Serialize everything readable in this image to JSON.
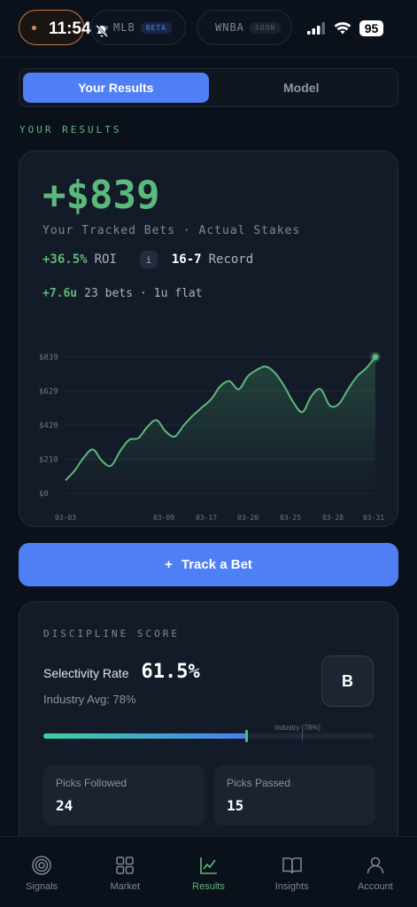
{
  "status": {
    "time": "11:54",
    "battery": "95"
  },
  "sports": [
    {
      "label": "MLB",
      "badge": "BETA"
    },
    {
      "label": "WNBA",
      "badge": "SOON"
    }
  ],
  "tabs": {
    "results": "Your Results",
    "model": "Model"
  },
  "section_label": "YOUR RESULTS",
  "results": {
    "amount": "+$839",
    "subtitle": "Your Tracked Bets · Actual Stakes",
    "roi": "+36.5%",
    "roi_label": "ROI",
    "info_icon": "i",
    "record": "16-7",
    "record_label": "Record",
    "units": "+7.6u",
    "bets": "23 bets",
    "separator": "·",
    "stake": "1u flat"
  },
  "chart_data": {
    "type": "area",
    "x_ticks": [
      "03-03",
      "03-09",
      "03-17",
      "03-20",
      "03-25",
      "03-28",
      "03-31"
    ],
    "y_ticks": [
      "$839",
      "$629",
      "$420",
      "$210",
      "$0"
    ],
    "ylim": [
      0,
      839
    ],
    "values": [
      80,
      140,
      220,
      270,
      200,
      170,
      260,
      330,
      340,
      410,
      450,
      380,
      350,
      420,
      480,
      530,
      580,
      660,
      690,
      640,
      720,
      760,
      780,
      740,
      660,
      560,
      500,
      600,
      640,
      540,
      550,
      640,
      720,
      770,
      839
    ],
    "grid": true
  },
  "track_button": {
    "icon": "+",
    "label": "Track a Bet"
  },
  "discipline": {
    "title": "DISCIPLINE SCORE",
    "selectivity_label": "Selectivity Rate",
    "selectivity_value": "61.5%",
    "industry_avg": "Industry Avg: 78%",
    "grade": "B",
    "selectivity_fraction": 0.615,
    "industry_fraction": 0.78,
    "industry_marker_label": "Industry (78%)",
    "picks_followed_label": "Picks Followed",
    "picks_followed": "24",
    "picks_passed_label": "Picks Passed",
    "picks_passed": "15"
  },
  "nav": [
    {
      "label": "Signals",
      "icon": "signals-icon"
    },
    {
      "label": "Market",
      "icon": "grid-icon"
    },
    {
      "label": "Results",
      "icon": "chart-line-icon"
    },
    {
      "label": "Insights",
      "icon": "book-icon"
    },
    {
      "label": "Account",
      "icon": "person-icon"
    }
  ],
  "colors": {
    "accent_blue": "#4f7ff5",
    "positive_green": "#5cb97c",
    "active_sport": "#d58a58"
  }
}
